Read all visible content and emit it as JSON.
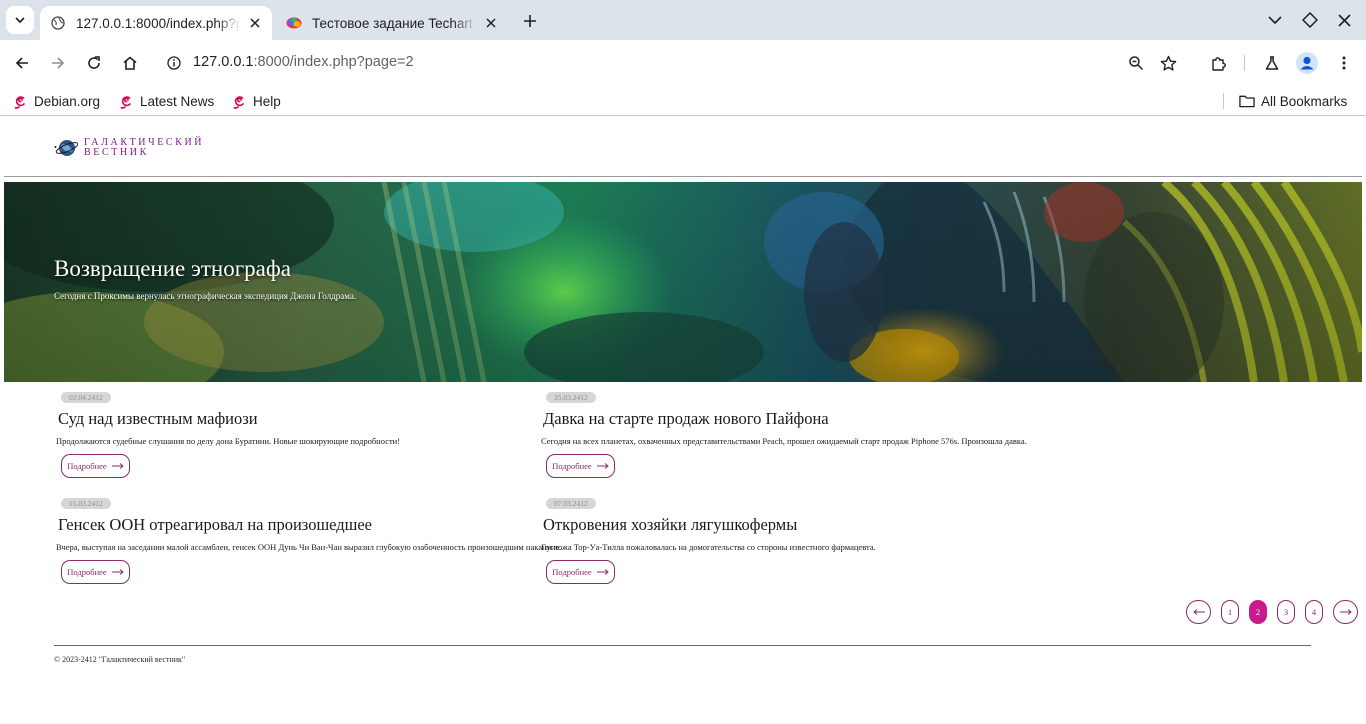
{
  "browser": {
    "tabs": [
      {
        "title": "127.0.0.1:8000/index.php?page=2",
        "active": true
      },
      {
        "title": "Тестовое задание Techart",
        "active": false
      }
    ],
    "address": {
      "host": "127.0.0.1",
      "rest": ":8000/index.php?page=2"
    },
    "bookmarks": [
      {
        "label": "Debian.org",
        "icon": "debian-swirl-icon"
      },
      {
        "label": "Latest News",
        "icon": "debian-swirl-icon"
      },
      {
        "label": "Help",
        "icon": "debian-swirl-icon"
      }
    ],
    "all_bookmarks_label": "All Bookmarks",
    "colors": {
      "tabstrip": "#dde3ea",
      "profile": "#0b57d0",
      "debian": "#d70751"
    }
  },
  "site": {
    "logo_line1": "Галактический",
    "logo_line2": "Вестник",
    "brand_color": "#c81b8d"
  },
  "hero": {
    "title": "Возвращение этнографа",
    "lead": "Сегодня с Проксимы вернулась этнографическая экспедиция Джона Голдрама."
  },
  "news": [
    {
      "date": "02.04.2412",
      "title": "Суд над известным мафиози",
      "lead": "Продолжаются судебные слушания по делу дона Буратини. Новые шокирующие подробности!",
      "more": "Подробнее"
    },
    {
      "date": "25.03.2412",
      "title": "Давка на старте продаж нового Пайфона",
      "lead": "Сегодня на всех планетах, охваченных представительствами Peach, прошел ожидаемый старт продаж Piphone 576s. Произошла давка.",
      "more": "Подробнее"
    },
    {
      "date": "15.03.2412",
      "title": "Генсек ООН отреагировал на произошедшее",
      "lead": "Вчера, выступая на заседании малой ассамблеи, генсек ООН Дунь Чи Ван-Чан выразил глубокую озабоченность произошедшим накануне.",
      "more": "Подробнее"
    },
    {
      "date": "07.03.2412",
      "title": "Откровения хозяйки лягушкофермы",
      "lead": "Госпожа Тор-Уа-Тилла пожаловалась на домогательства со стороны известного фармацевта.",
      "more": "Подробнее"
    }
  ],
  "pagination": {
    "pages": [
      "1",
      "2",
      "3",
      "4"
    ],
    "current": "2"
  },
  "footer": {
    "copyright": "© 2023-2412 \"Галактический вестник\""
  }
}
